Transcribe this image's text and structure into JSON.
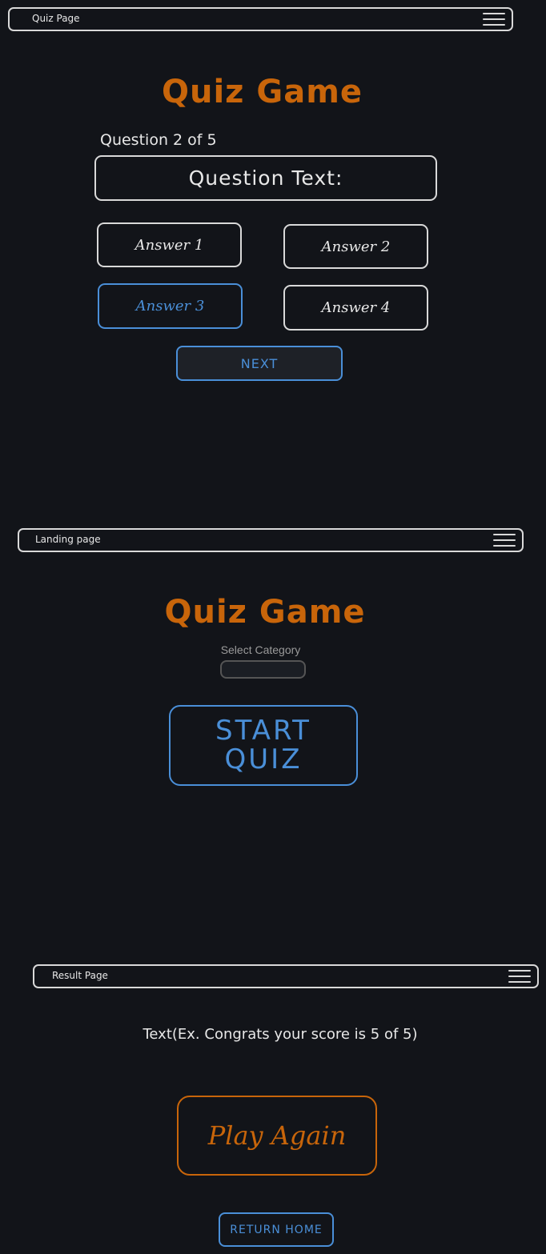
{
  "quiz_page": {
    "nav_title": "Quiz Page",
    "title": "Quiz Game",
    "progress": "Question 2 of 5",
    "question": "Question Text:",
    "answers": [
      "Answer 1",
      "Answer 2",
      "Answer 3",
      "Answer 4"
    ],
    "selected_answer_index": 2,
    "next_label": "NEXT"
  },
  "landing_page": {
    "nav_title": "Landing page",
    "title": "Quiz Game",
    "category_label": "Select Category",
    "category_value": "",
    "start_line1": "START",
    "start_line2": "QUIZ"
  },
  "result_page": {
    "nav_title": "Result Page",
    "result_text": "Text(Ex. Congrats your score is 5 of 5)",
    "play_again_label": "Play Again",
    "return_home_label": "RETURN HOME"
  },
  "colors": {
    "background": "#121419",
    "accent_orange": "#c8650a",
    "accent_blue": "#4a8fd8",
    "outline": "#d9d9d9"
  },
  "icons": [
    "hamburger-menu-icon"
  ]
}
